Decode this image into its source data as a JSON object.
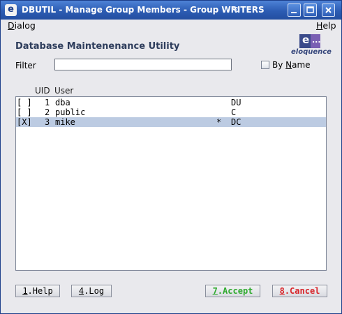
{
  "window": {
    "title": "DBUTIL - Manage Group Members - Group WRITERS",
    "app_icon": "e"
  },
  "menubar": {
    "dialog": {
      "pre": "",
      "mnemonic": "D",
      "rest": "ialog"
    },
    "help": {
      "pre": "",
      "mnemonic": "H",
      "rest": "elp"
    }
  },
  "header": {
    "title": "Database Maintenenance Utility",
    "logo_mark": "e",
    "logo_dots": "...",
    "logo_word": "eloquence"
  },
  "filter": {
    "label": "Filter",
    "value": "",
    "checkbox_pre": "By ",
    "checkbox_mnemonic": "N",
    "checkbox_rest": "ame",
    "checkbox_checked": false
  },
  "list": {
    "columns": {
      "uid": "UID",
      "user": "User"
    },
    "rows": [
      {
        "mark": "[ ]",
        "uid": "1",
        "user": "dba",
        "star": "",
        "flags": "DU",
        "selected": false
      },
      {
        "mark": "[ ]",
        "uid": "2",
        "user": "public",
        "star": "",
        "flags": "C",
        "selected": false
      },
      {
        "mark": "[X]",
        "uid": "3",
        "user": "mike",
        "star": "*",
        "flags": "DC",
        "selected": true
      }
    ]
  },
  "buttons": {
    "help": {
      "num": "1",
      "rest": ".Help"
    },
    "log": {
      "num": "4",
      "rest": ".Log"
    },
    "accept": {
      "num": "7",
      "rest": ".Accept"
    },
    "cancel": {
      "num": "8",
      "rest": ".Cancel"
    }
  },
  "colors": {
    "titlebar": "#2c5cb3",
    "selection": "#bccbe2",
    "accept": "#2eaa2e",
    "cancel": "#d8262b",
    "logo": "#3a4a8a"
  }
}
